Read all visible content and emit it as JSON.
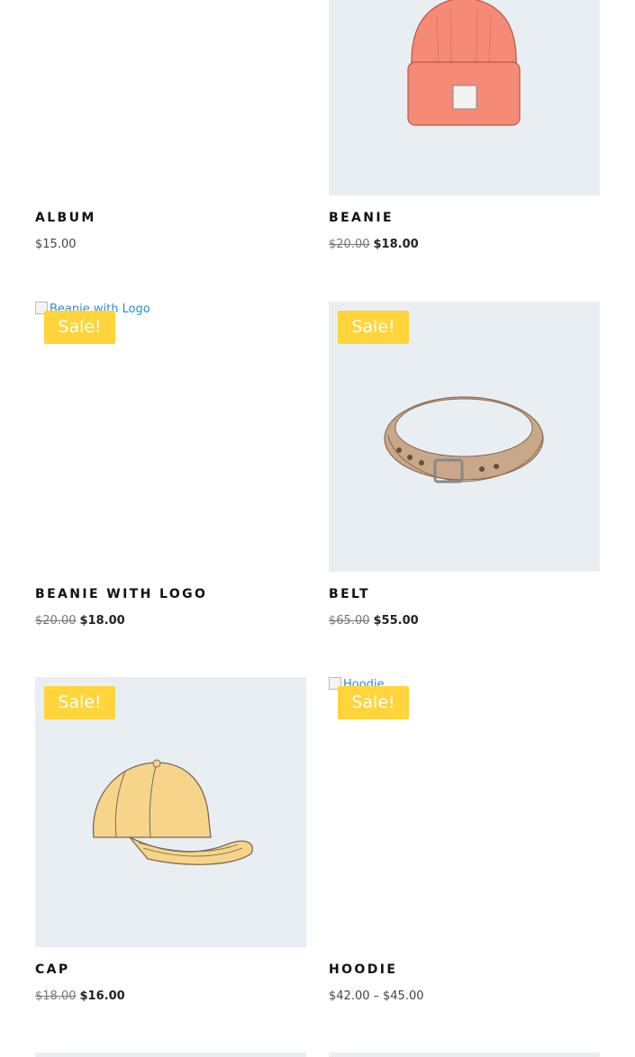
{
  "products": [
    {
      "name": "ALBUM",
      "price": "$15.00"
    },
    {
      "name": "BEANIE",
      "regular_price": "$20.00",
      "sale_price": "$18.00"
    },
    {
      "name": "BEANIE WITH LOGO",
      "image_alt": "Beanie with Logo",
      "badge": "Sale!",
      "regular_price": "$20.00",
      "sale_price": "$18.00"
    },
    {
      "name": "BELT",
      "badge": "Sale!",
      "regular_price": "$65.00",
      "sale_price": "$55.00"
    },
    {
      "name": "CAP",
      "badge": "Sale!",
      "regular_price": "$18.00",
      "sale_price": "$16.00"
    },
    {
      "name": "HOODIE",
      "image_alt": "Hoodie",
      "badge": "Sale!",
      "price_min": "$42.00",
      "price_sep": "–",
      "price_max": "$45.00"
    }
  ],
  "colors": {
    "badge_bg": "#ffd53b",
    "image_bg": "#e9eef3",
    "beanie": "#f58a76",
    "belt": "#c9a88a",
    "cap": "#f6d48a"
  },
  "icons": {
    "beanie": "beanie-illustration",
    "belt": "belt-illustration",
    "cap": "cap-illustration"
  }
}
